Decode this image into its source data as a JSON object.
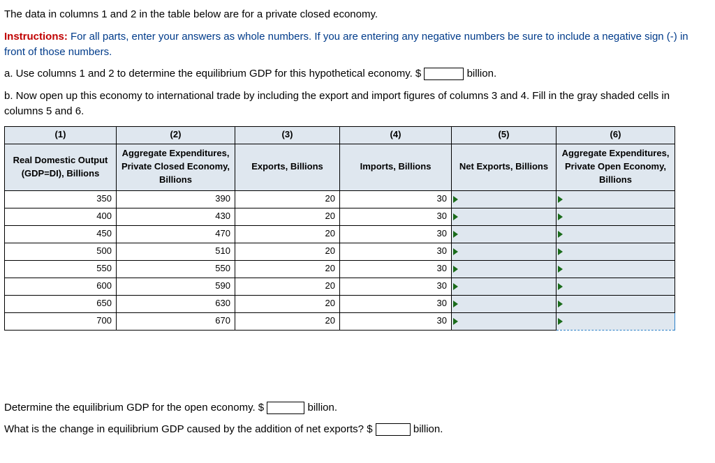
{
  "intro": "The data in columns 1 and 2 in the table below are for a private closed economy.",
  "instructions_label": "Instructions:",
  "instructions_text": " For all parts, enter your answers as whole numbers. If you are entering any negative numbers be sure to include a negative sign (-) in front of those numbers.",
  "part_a_pre": "a. Use columns 1 and 2 to determine the equilibrium GDP for this hypothetical economy. $ ",
  "part_a_post": " billion.",
  "part_b": "b. Now open up this economy to international trade by including the export and import figures of columns 3 and 4. Fill in the gray shaded cells in columns 5 and 6.",
  "col_nums": [
    "(1)",
    "(2)",
    "(3)",
    "(4)",
    "(5)",
    "(6)"
  ],
  "headers": [
    "Real Domestic Output (GDP=DI), Billions",
    "Aggregate Expenditures, Private Closed Economy, Billions",
    "Exports, Billions",
    "Imports, Billions",
    "Net Exports, Billions",
    "Aggregate Expenditures, Private Open Economy, Billions"
  ],
  "rows": [
    {
      "gdp": "350",
      "ae_closed": "390",
      "exports": "20",
      "imports": "30"
    },
    {
      "gdp": "400",
      "ae_closed": "430",
      "exports": "20",
      "imports": "30"
    },
    {
      "gdp": "450",
      "ae_closed": "470",
      "exports": "20",
      "imports": "30"
    },
    {
      "gdp": "500",
      "ae_closed": "510",
      "exports": "20",
      "imports": "30"
    },
    {
      "gdp": "550",
      "ae_closed": "550",
      "exports": "20",
      "imports": "30"
    },
    {
      "gdp": "600",
      "ae_closed": "590",
      "exports": "20",
      "imports": "30"
    },
    {
      "gdp": "650",
      "ae_closed": "630",
      "exports": "20",
      "imports": "30"
    },
    {
      "gdp": "700",
      "ae_closed": "670",
      "exports": "20",
      "imports": "30"
    }
  ],
  "q_open_pre": "Determine the equilibrium GDP for the open economy. $ ",
  "q_open_post": " billion.",
  "q_change_pre": "What is the change in equilibrium GDP caused by the addition of net exports? $ ",
  "q_change_post": " billion."
}
